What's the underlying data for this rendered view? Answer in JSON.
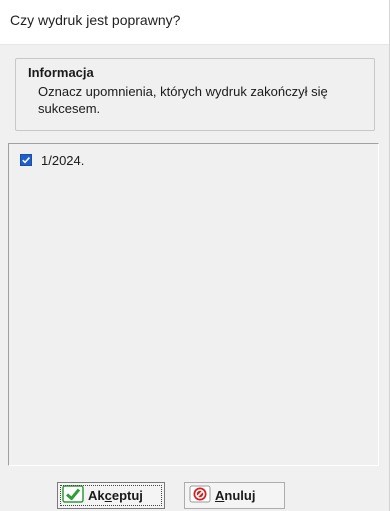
{
  "window": {
    "title": "Czy wydruk jest poprawny?"
  },
  "info": {
    "title": "Informacja",
    "text": "Oznacz upomnienia, których wydruk zakończył się sukcesem."
  },
  "list": {
    "items": [
      {
        "label": "1/2024.",
        "checked": true
      }
    ]
  },
  "buttons": {
    "accept": {
      "pre": "Ak",
      "mnemonic": "c",
      "post": "eptuj",
      "icon": "check-icon"
    },
    "cancel": {
      "pre": "",
      "mnemonic": "A",
      "post": "nuluj",
      "icon": "cancel-icon"
    }
  },
  "colors": {
    "accent": "#1f5fcc",
    "accept_icon": "#2e9e3a",
    "cancel_icon": "#d42020"
  }
}
